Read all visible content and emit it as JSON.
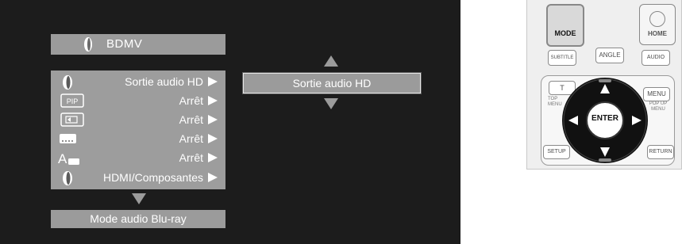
{
  "osd": {
    "title": "BDMV",
    "menu_rows": [
      {
        "label": "Sortie audio HD",
        "icon": "speaker-icon"
      },
      {
        "label": "Arrêt",
        "icon": "pip-icon"
      },
      {
        "label": "Arrêt",
        "icon": "secondary-audio-icon"
      },
      {
        "label": "Arrêt",
        "icon": "subtitle-icon"
      },
      {
        "label": "Arrêt",
        "icon": "subtitle-style-icon"
      },
      {
        "label": "HDMI/Composantes",
        "icon": "speaker-icon"
      }
    ],
    "footer": "Mode audio Blu-ray",
    "selected_option": "Sortie audio HD",
    "pip_icon_text": "PIP",
    "subtitle_style_text": "A"
  },
  "remote": {
    "mode": "MODE",
    "home": "HOME",
    "subtitle": "SUBTITLE",
    "angle": "ANGLE",
    "audio": "AUDIO",
    "t": "T",
    "top_menu": "TOP MENU",
    "menu": "MENU",
    "popup_menu": "POP UP MENU",
    "enter": "ENTER",
    "setup": "SETUP",
    "return": "RETURN"
  },
  "colors": {
    "screen_bg": "#1c1c1c",
    "panel_gray": "#9b9b9b",
    "text": "#ffffff"
  }
}
